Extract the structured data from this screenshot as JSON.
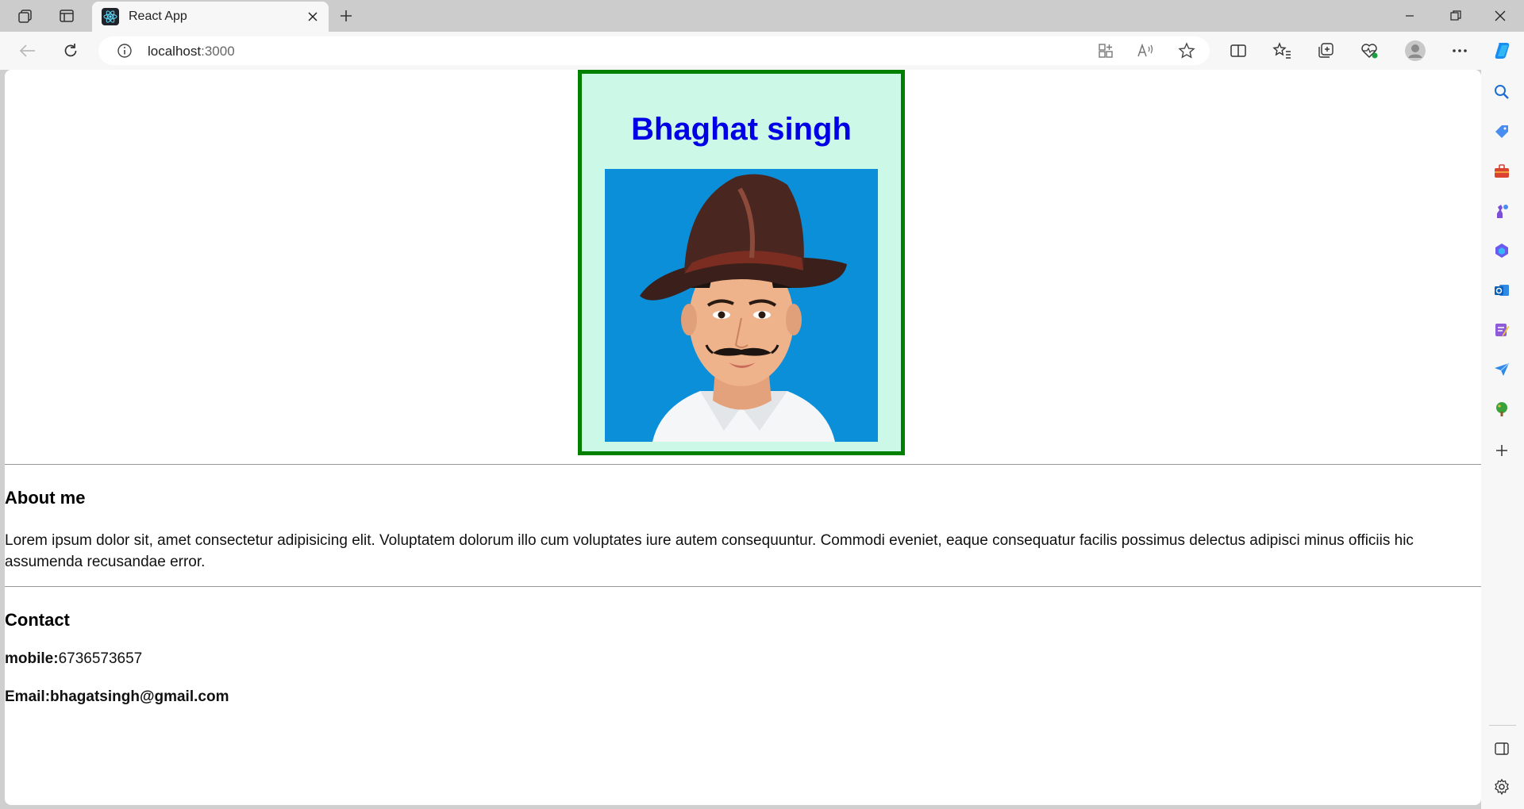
{
  "browser": {
    "tab_title": "React App",
    "url_host": "localhost",
    "url_port": ":3000"
  },
  "icons": {
    "workspaces": "workspaces-icon",
    "tab_actions": "tab-actions-icon",
    "favicon": "react-logo-icon",
    "close_tab": "close-icon",
    "new_tab": "plus-icon",
    "minimize": "minimize-icon",
    "restore": "restore-icon",
    "close_window": "close-icon",
    "back": "back-arrow-icon",
    "refresh": "refresh-icon",
    "site_info": "info-icon",
    "app_available": "apps-icon",
    "read_aloud": "read-aloud-icon",
    "favorite": "star-icon",
    "split_screen": "split-screen-icon",
    "favorites": "favorites-icon",
    "collections": "collections-icon",
    "browser_essentials": "heart-pulse-icon",
    "profile": "avatar-icon",
    "more": "more-icon",
    "copilot": "copilot-icon"
  },
  "page": {
    "card_title": "Bhaghat singh",
    "portrait_alt": "Bhagat Singh portrait",
    "about_heading": "About me",
    "about_text": "Lorem ipsum dolor sit, amet consectetur adipisicing elit. Voluptatem dolorum illo cum voluptates iure autem consequuntur. Commodi eveniet, eaque consequatur facilis possimus delectus adipisci minus officiis hic assumenda recusandae error.",
    "contact_heading": "Contact",
    "mobile_label": "mobile:",
    "mobile_value": "6736573657",
    "email_text": "Email:bhagatsingh@gmail.com"
  },
  "colors": {
    "card_border": "#008000",
    "card_bg": "#ccf8e8",
    "title": "#0000e6",
    "portrait_bg": "#0a8fd8"
  }
}
